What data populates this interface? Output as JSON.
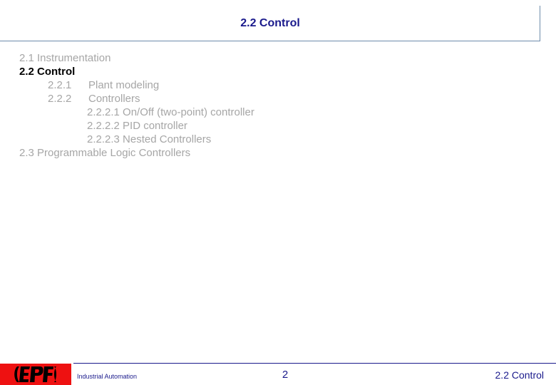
{
  "slide": {
    "title": "2.2 Control",
    "accent_color": "#1a1a8c",
    "rule_color": "#6e8cab",
    "logo_color": "#ee1111",
    "dim_text_color": "#a6a6a6"
  },
  "outline": {
    "rows": [
      {
        "level": 1,
        "number": "",
        "text": "2.1 Instrumentation",
        "emphasis": false
      },
      {
        "level": 1,
        "number": "",
        "text": "2.2 Control",
        "emphasis": true
      },
      {
        "level": 2,
        "number": "2.2.1",
        "text": "Plant modeling",
        "emphasis": false
      },
      {
        "level": 2,
        "number": "2.2.2",
        "text": "Controllers",
        "emphasis": false
      },
      {
        "level": 3,
        "number": "",
        "text": "2.2.2.1 On/Off (two-point) controller",
        "emphasis": false
      },
      {
        "level": 3,
        "number": "",
        "text": "2.2.2.2 PID controller",
        "emphasis": false
      },
      {
        "level": 3,
        "number": "",
        "text": "2.2.2.3 Nested Controllers",
        "emphasis": false
      },
      {
        "level": 1,
        "number": "",
        "text": "2.3 Programmable Logic Controllers",
        "emphasis": false
      }
    ]
  },
  "footer": {
    "logo_text": "EPFL",
    "course": "Industrial Automation",
    "page_number": "2",
    "section": "2.2 Control"
  }
}
